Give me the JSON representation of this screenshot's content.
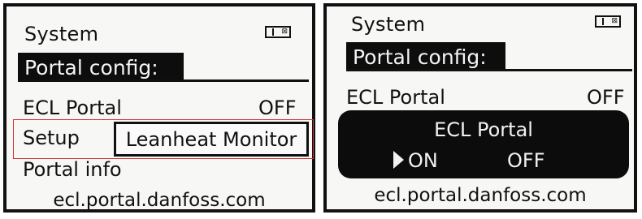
{
  "left": {
    "title": "System",
    "battery_mark": "⊠",
    "header": "Portal config:",
    "rows": {
      "ecl_label": "ECL Portal",
      "ecl_value": "OFF",
      "setup_label": "Setup",
      "setup_value": "Leanheat Monitor",
      "info_label": "Portal info"
    },
    "url": "ecl.portal.danfoss.com",
    "highlight_color": "#d33333"
  },
  "right": {
    "title": "System",
    "battery_mark": "⊠",
    "header": "Portal config:",
    "rows": {
      "ecl_label": "ECL Portal",
      "ecl_value": "OFF"
    },
    "popup": {
      "title": "ECL Portal",
      "option_on": "ON",
      "option_off": "OFF",
      "selected": "ON"
    },
    "url": "ecl.portal.danfoss.com"
  }
}
